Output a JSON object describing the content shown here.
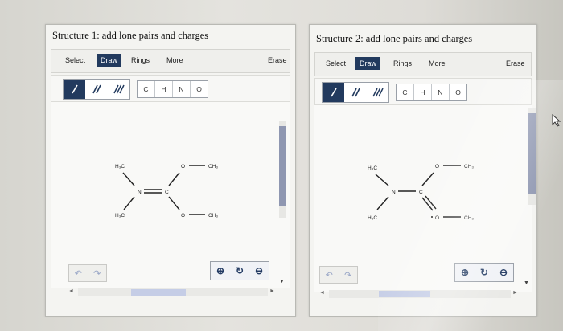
{
  "structure1": {
    "title": "Structure 1: add lone pairs and charges",
    "tabs": {
      "select": "Select",
      "draw": "Draw",
      "rings": "Rings",
      "more": "More",
      "erase": "Erase"
    },
    "atoms": {
      "c": "C",
      "h": "H",
      "n": "N",
      "o": "O"
    },
    "molecule": {
      "h3c_top": "H₃C",
      "h3c_bottom": "H₃C",
      "n": "N",
      "c": "C",
      "o_top": "O",
      "o_bottom": "O",
      "ch3_top": "CH₃",
      "ch3_bottom": "CH₃"
    }
  },
  "structure2": {
    "title": "Structure 2: add lone pairs and charges",
    "tabs": {
      "select": "Select",
      "draw": "Draw",
      "rings": "Rings",
      "more": "More",
      "erase": "Erase"
    },
    "atoms": {
      "c": "C",
      "h": "H",
      "n": "N",
      "o": "O"
    },
    "molecule": {
      "h3c_top": "H₃C",
      "h3c_bottom": "H₃C",
      "n": "N",
      "c": "C",
      "o_top": "O",
      "o_bottom": "O",
      "ch3_top": "CH₃",
      "ch3_bottom": "CH₃"
    }
  },
  "icons": {
    "undo": "undo-icon",
    "redo": "redo-icon",
    "zoom_in": "zoom-in-icon",
    "reset": "reset-zoom-icon",
    "zoom_out": "zoom-out-icon"
  },
  "colors": {
    "accent": "#223a5e",
    "scroll_thumb": "#8f97b1"
  }
}
